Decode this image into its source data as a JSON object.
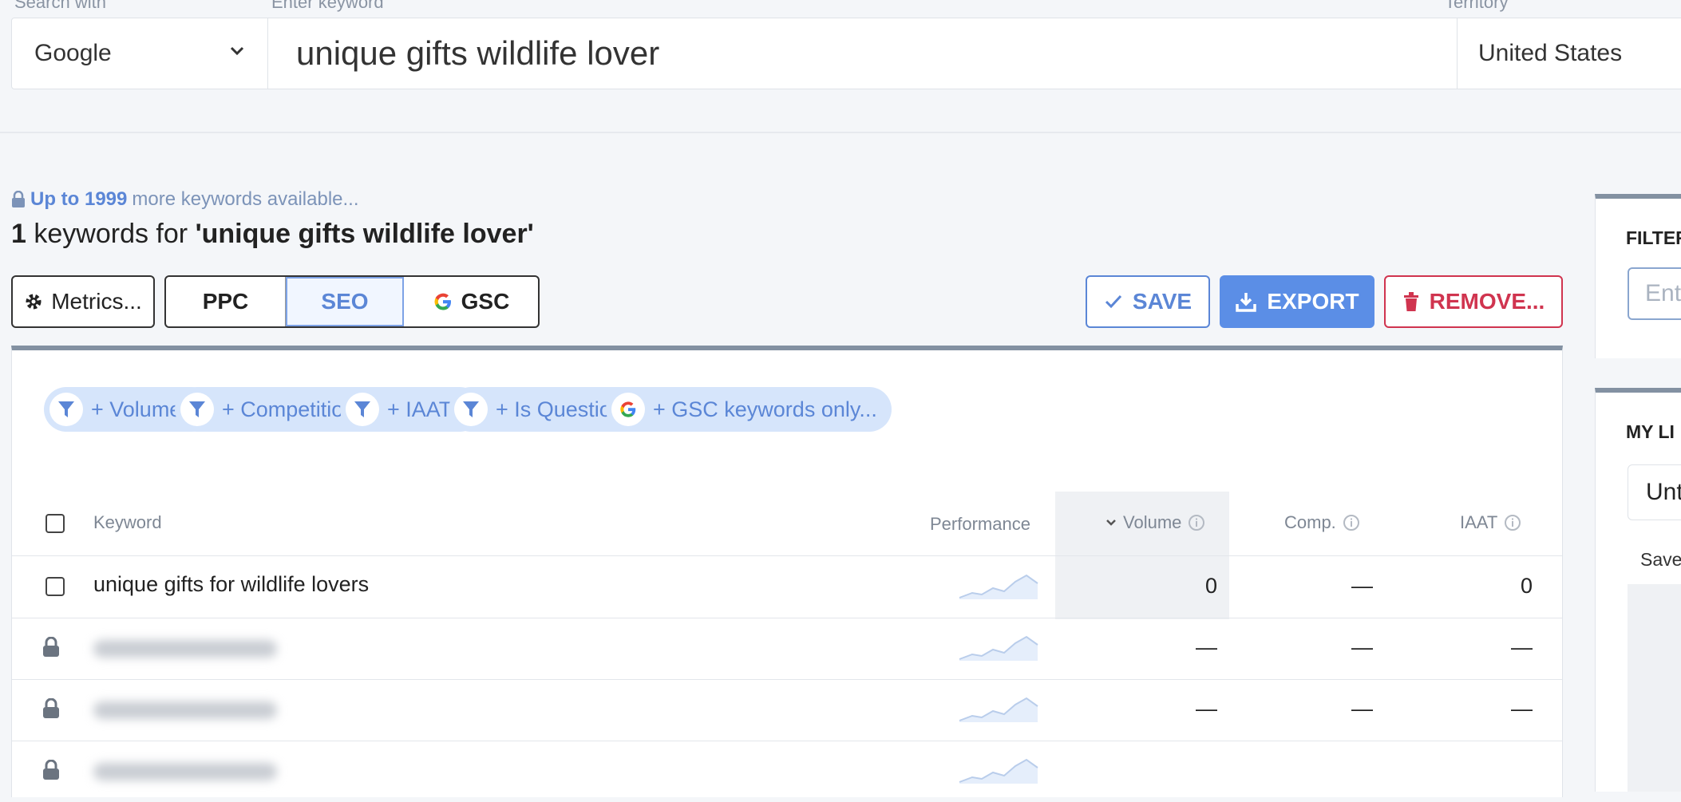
{
  "search": {
    "engine_label": "Search with",
    "keyword_label": "Enter keyword",
    "territory_label": "Territory",
    "engine": "Google",
    "keyword": "unique gifts wildlife lover",
    "territory": "United States"
  },
  "info": {
    "available_prefix": "Up to 1999",
    "available_suffix": "more keywords available...",
    "count": "1",
    "count_text": "keywords for",
    "query": "'unique gifts wildlife lover'"
  },
  "toolbar": {
    "metrics_label": "Metrics...",
    "ppc_label": "PPC",
    "seo_label": "SEO",
    "gsc_label": "GSC",
    "save_label": "SAVE",
    "export_label": "EXPORT",
    "remove_label": "REMOVE..."
  },
  "filters": [
    {
      "label": "+ Volume..."
    },
    {
      "label": "+ Competition..."
    },
    {
      "label": "+ IAAT..."
    },
    {
      "label": "+ Is Question..."
    },
    {
      "label": "+ GSC keywords only..."
    }
  ],
  "table": {
    "columns": {
      "keyword": "Keyword",
      "performance": "Performance",
      "volume": "Volume",
      "comp": "Comp.",
      "iaat": "IAAT"
    },
    "rows": [
      {
        "keyword": "unique gifts for wildlife lovers",
        "volume": "0",
        "comp": "—",
        "iaat": "0",
        "locked": false
      },
      {
        "keyword": "",
        "volume": "—",
        "comp": "—",
        "iaat": "—",
        "locked": true
      },
      {
        "keyword": "",
        "volume": "—",
        "comp": "—",
        "iaat": "—",
        "locked": true
      },
      {
        "keyword": "",
        "volume": "",
        "comp": "",
        "iaat": "",
        "locked": true
      }
    ]
  },
  "side": {
    "filter_title": "FILTER",
    "filter_placeholder": "Ente",
    "lists_title": "MY LI",
    "list_selected": "Unt",
    "saved_label": "Save"
  },
  "colors": {
    "accent": "#5b86d6",
    "danger": "#d0344f",
    "chip_bg": "#d6e5fb"
  }
}
